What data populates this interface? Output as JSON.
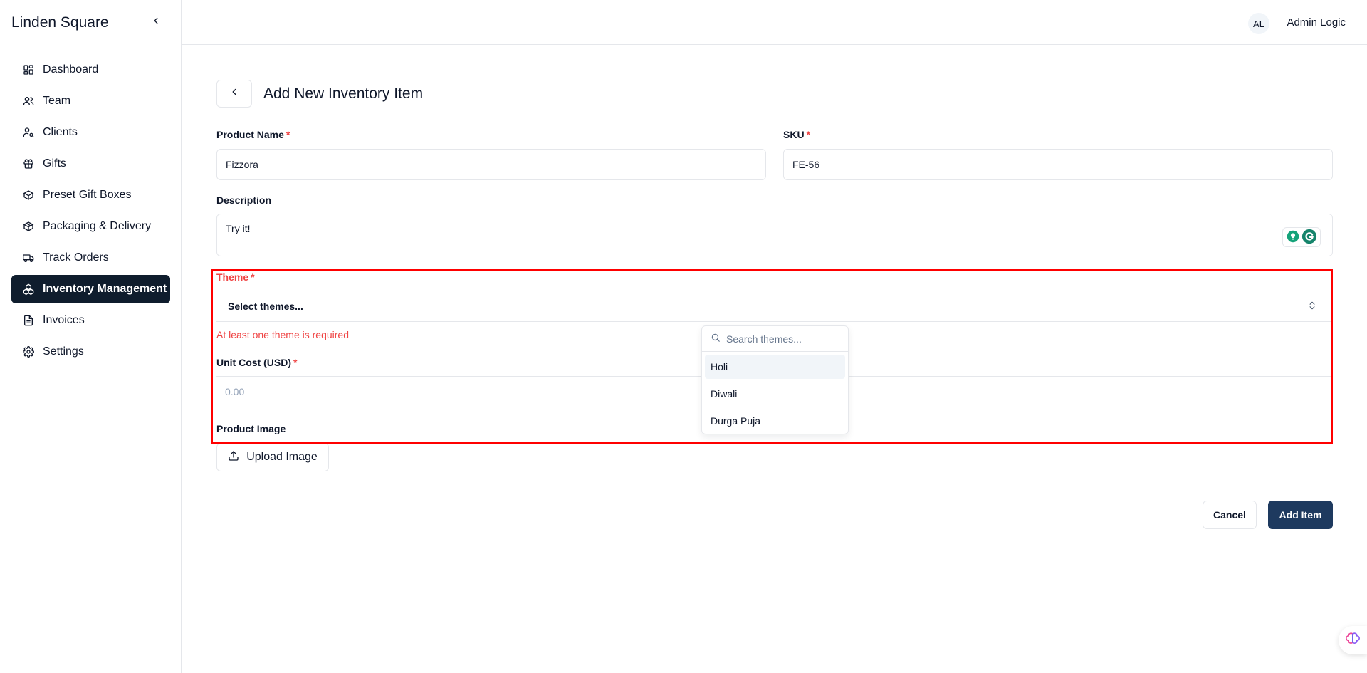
{
  "sidebar": {
    "brand": "Linden Square",
    "items": [
      {
        "label": "Dashboard",
        "icon": "dashboard-icon"
      },
      {
        "label": "Team",
        "icon": "users-icon"
      },
      {
        "label": "Clients",
        "icon": "user-key-icon"
      },
      {
        "label": "Gifts",
        "icon": "gift-icon"
      },
      {
        "label": "Preset Gift Boxes",
        "icon": "box-icon"
      },
      {
        "label": "Packaging & Delivery",
        "icon": "package-icon"
      },
      {
        "label": "Track Orders",
        "icon": "truck-icon"
      },
      {
        "label": "Inventory Management",
        "icon": "boxes-icon",
        "active": true
      },
      {
        "label": "Invoices",
        "icon": "file-icon"
      },
      {
        "label": "Settings",
        "icon": "gear-icon"
      }
    ]
  },
  "header": {
    "avatar_initials": "AL",
    "user_name": "Admin Logic"
  },
  "page": {
    "title": "Add New Inventory Item"
  },
  "form": {
    "product_name": {
      "label": "Product Name",
      "required": "*",
      "value": "Fizzora"
    },
    "sku": {
      "label": "SKU",
      "required": "*",
      "value": "FE-56"
    },
    "description": {
      "label": "Description",
      "value": "Try it!"
    },
    "theme": {
      "label": "Theme",
      "required": "*",
      "placeholder": "Select themes...",
      "error": "At least one theme is required",
      "search_placeholder": "Search themes...",
      "options": [
        "Holi",
        "Diwali",
        "Durga Puja"
      ]
    },
    "unit_cost": {
      "label": "Unit Cost (USD)",
      "required": "*",
      "placeholder": "0.00"
    },
    "product_image": {
      "label": "Product Image",
      "upload_label": "Upload Image"
    }
  },
  "actions": {
    "cancel": "Cancel",
    "add": "Add Item"
  },
  "colors": {
    "accent": "#1e3a5f",
    "active_nav": "#0f1d2d",
    "error": "#ef4444",
    "highlight": "#ff0000"
  }
}
